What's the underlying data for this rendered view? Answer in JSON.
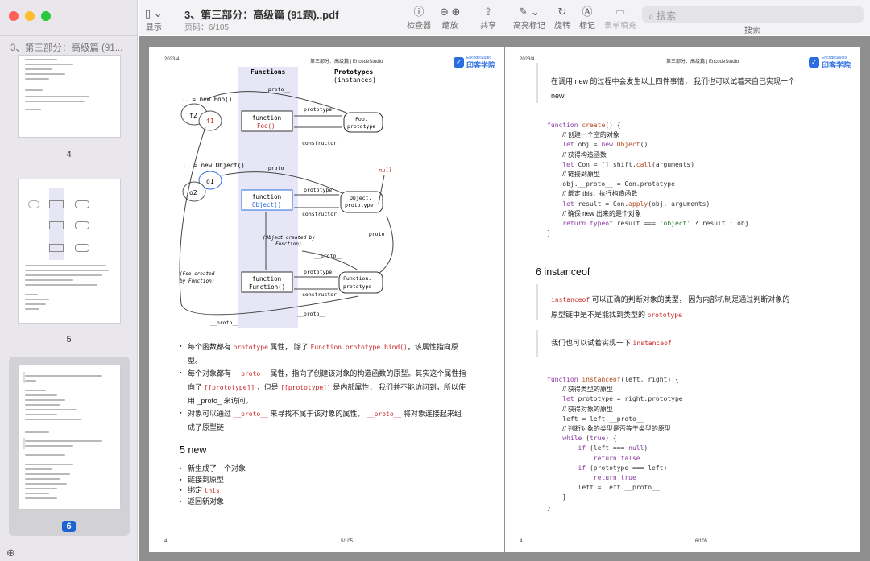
{
  "window": {
    "title": "3、第三部分：高级篇 (91题)..pdf",
    "page_indicator": "页码：6/105"
  },
  "sidebar": {
    "header": "3、第三部分：高级篇 (91...",
    "thumbs": [
      {
        "label": "4"
      },
      {
        "label": "5"
      },
      {
        "label": "6"
      }
    ],
    "add_icon": "⊕"
  },
  "toolbar": {
    "display": "显示",
    "inspector": "检查器",
    "zoom": "缩放",
    "share": "共享",
    "highlight": "高亮标记",
    "rotate": "旋转",
    "markup": "标记",
    "form_fill": "表单填充",
    "search_placeholder": "搜索",
    "search_label": "搜索"
  },
  "page_left": {
    "hdr_date": "2023/4",
    "hdr_title": "第三部分：高级篇 | EncodeStudio",
    "logo_text": "印客学院",
    "logo_sub": "EncodeStudio",
    "diagram": {
      "col_functions": "Functions",
      "col_prototypes": "Prototypes",
      "col_instances": "(instances)",
      "new_foo": ".. = new Foo()",
      "new_object": ".. = new Object()",
      "f2": "f2",
      "f1": "f1",
      "o1": "o1",
      "o2": "o2",
      "function": "function",
      "foo": "Foo()",
      "object": "Object()",
      "function2": "Function()",
      "foo_proto": "Foo.",
      "proto_word": "prototype",
      "obj_proto": "Object.",
      "fn_proto": "Function.",
      "prototype": "prototype",
      "constructor": "constructor",
      "proto": "__proto__",
      "null": "null",
      "obj_created": "(Object created by",
      "by_function": "Function)",
      "foo_created": "(Foo created",
      "by_function2": "by Function)"
    },
    "bullets1": [
      "每个函数都有 prototype 属性， 除了 Function.prototype.bind() ，该属性指向原型。",
      "每个对象都有 __proto__ 属性，指向了创建该对象的构造函数的原型。其实这个属性指向了 [[prototype]] ，但是 [[prototype]] 是内部属性， 我们并不能访问到，所以使用 _proto_ 来访问。",
      "对象可以通过 __proto__ 来寻找不属于该对象的属性， __proto__ 将对象连接起来组成了原型链"
    ],
    "b1a": "每个函数都有",
    "b1b": "prototype",
    "b1c": "属性， 除了",
    "b1d": "Function.prototype.bind()",
    "b1e": "，该属性指向原",
    "b1f": "型。",
    "b2a": "每个对象都有",
    "b2b": "__proto__",
    "b2c": "属性，指向了创建该对象的构造函数的原型。其实这个属性指",
    "b2d": "向了",
    "b2e": "[[prototype]]",
    "b2f": "，但是",
    "b2g": "[[prototype]]",
    "b2h": "是内部属性， 我们并不能访问到，所以使",
    "b2i": "用 _proto_ 来访问。",
    "b3a": "对象可以通过",
    "b3b": "__proto__",
    "b3c": "来寻找不属于该对象的属性，",
    "b3d": "__proto__",
    "b3e": "将对象连接起来组",
    "b3f": "成了原型链",
    "section": "5 new",
    "new_a": "新生成了一个对象",
    "new_b": "链接到原型",
    "new_c": "绑定",
    "new_c2": "this",
    "new_d": "返回新对象",
    "foot_left": "4",
    "foot_mid": "5/105"
  },
  "page_right": {
    "hdr_date": "2023/4",
    "hdr_title": "第三部分：高级篇 | EncodeStudio",
    "logo_text": "印客学院",
    "logo_sub": "EncodeStudio",
    "intro": "在调用 new 的过程中会发生以上四件事情， 我们也可以试着来自己实现一个",
    "intro2": "new",
    "code1": [
      "function create() {",
      "    // 创建一个空的对象",
      "    let obj = new Object()",
      "    // 获得构造函数",
      "    let Con = [].shift.call(arguments)",
      "    // 链接到原型",
      "    obj.__proto__ = Con.prototype",
      "    // 绑定 this，执行构造函数",
      "    let result = Con.apply(obj, arguments)",
      "    // 确保 new 出来的是个对象",
      "    return typeof result === 'object' ? result : obj",
      "}"
    ],
    "section": "6 instanceof",
    "q1a": "instanceof",
    "q1b": "可以正确的判断对象的类型， 因为内部机制是通过判断对象的",
    "q1c": "原型链中是不是能找到类型的",
    "q1d": "prototype",
    "q2a": "我们也可以试着实现一下",
    "q2b": "instanceof",
    "code2": [
      "function instanceof(left, right) {",
      "    // 获得类型的原型",
      "    let prototype = right.prototype",
      "    // 获得对象的原型",
      "    left = left.__proto__",
      "    // 判断对象的类型是否等于类型的原型",
      "    while (true) {",
      "        if (left === null)",
      "            return false",
      "        if (prototype === left)",
      "            return true",
      "        left = left.__proto__",
      "    }",
      "}"
    ],
    "foot_left": "4",
    "foot_mid": "6/105"
  }
}
